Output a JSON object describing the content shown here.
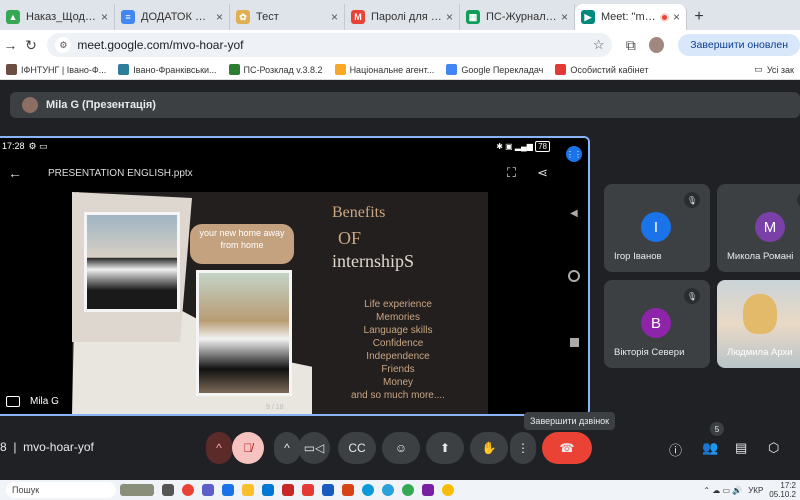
{
  "browser": {
    "tabs": [
      {
        "title": "Наказ_Щодо под...",
        "fav_color": "#34a853"
      },
      {
        "title": "ДОДАТОК 6 Заоч",
        "fav_color": "#4285f4"
      },
      {
        "title": "Тест",
        "fav_color": "#e0b050"
      },
      {
        "title": "Паролі для самор",
        "fav_color": "#ea4335"
      },
      {
        "title": "ПС-Журнал успіш",
        "fav_color": "#0f9d58"
      },
      {
        "title": "Meet: \"mvo-h",
        "fav_color": "#00897b"
      }
    ],
    "url": "meet.google.com/mvo-hoar-yof",
    "end_call_pill": "Завершити оновлен",
    "bookmarks": [
      "ІФНТУНГ | Івано-Ф...",
      "Івано-Франківськи...",
      "ПС-Розклад v.3.8.2",
      "Національне агент...",
      "Google Перекладач",
      "Особистий кабінет"
    ],
    "bookmarks_all": "Усі зак"
  },
  "meet": {
    "presenter_bar": "Mila G (Презентація)",
    "phone_time": "17:28",
    "phone_battery": "78",
    "ppt_file": "PRESENTATION  ENGLISH.pptx",
    "slide": {
      "bubble": "your new home away from home",
      "title_1": "Benefits",
      "title_2": "OF",
      "title_3": "internshipS",
      "list": [
        "Life experience",
        "Memories",
        "Language skills",
        "Confidence",
        "Independence",
        "Friends",
        "Money",
        "and so much more...."
      ],
      "page": "9 / 18"
    },
    "main_label": "Mila G",
    "participants": [
      {
        "initial": "І",
        "name": "Ігор Іванов",
        "color": "#1a73e8",
        "muted": true
      },
      {
        "initial": "М",
        "name": "Микола Романі",
        "color": "#7b3fa8",
        "muted": true
      },
      {
        "initial": "В",
        "name": "Вікторія Севери",
        "color": "#8e24aa",
        "muted": true
      },
      {
        "initial": "",
        "name": "Людмила Архи",
        "color": "",
        "muted": false
      }
    ],
    "tooltip": "Завершити дзвінок",
    "meeting_code": "mvo-hoar-yof",
    "participant_count": "5"
  },
  "taskbar": {
    "search": "Пошук",
    "lang": "УКР",
    "time": "17:2",
    "date": "05.10.2"
  }
}
